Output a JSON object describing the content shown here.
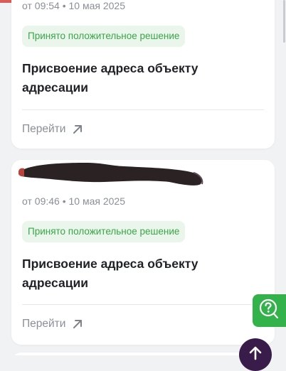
{
  "cards": [
    {
      "date": "от 09:54 • 10 мая 2025",
      "status": "Принято положительное решение",
      "title": "Присвоение адреса объекту адресации",
      "action": "Перейти"
    },
    {
      "date": "от 09:46 • 10 мая 2025",
      "status": "Принято положительное решение",
      "title": "Присвоение адреса объекту адресации",
      "action": "Перейти"
    }
  ],
  "colors": {
    "background": "#f1f2f4",
    "status_text": "#3aa548",
    "status_bg": "#eaf6ec",
    "help_button": "#33b14a",
    "scroll_up_button": "#3a1c4a"
  },
  "icons": {
    "go": "arrow-up-right-icon",
    "help": "chat-question-icon",
    "scroll_up": "arrow-up-icon"
  }
}
